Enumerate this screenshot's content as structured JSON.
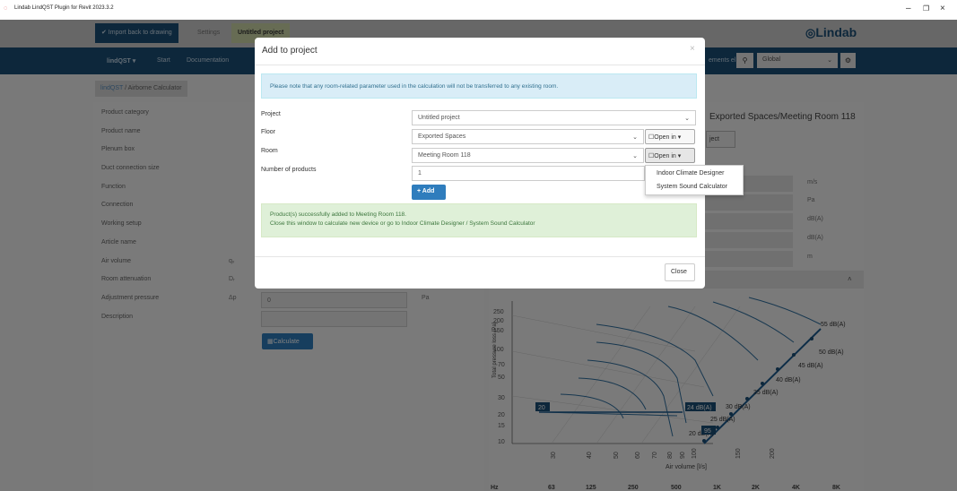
{
  "window": {
    "title": "Lindab LindQST Plugin for Revit 2023.3.2",
    "min": "–",
    "max": "❐",
    "close": "×"
  },
  "topbar": {
    "import": "✔ Import back to drawing",
    "settings": "Settings",
    "project": "Untitled project",
    "logo": "Lindab"
  },
  "navbar": {
    "menu": "lindQST ▾",
    "start": "Start",
    "docs": "Documentation",
    "search_hint": "ements el",
    "scope": "Global"
  },
  "breadcrumb": {
    "root": "lindQST",
    "sep": " / ",
    "page": "Airborne Calculator"
  },
  "form": {
    "labels": [
      "Product category",
      "Product name",
      "Plenum box",
      "Duct connection size",
      "Function",
      "Connection",
      "Working setup",
      "Article name",
      "Air volume",
      "Room attenuation",
      "Adjustment pressure",
      "Description"
    ],
    "symbols": {
      "air": "qᵥ",
      "room": "Dᵣ",
      "adj": "Δp"
    },
    "adj_value": "0",
    "adj_unit": "Pa",
    "calculate": "▦Calculate"
  },
  "right": {
    "title": "Exported Spaces/Meeting Room 118",
    "project_btn": "ject",
    "units": [
      "m/s",
      "Pa",
      "dB(A)",
      "dB(A)",
      "m"
    ]
  },
  "chart_data": {
    "type": "line",
    "ylabel": "Total pressure loss [Pa]",
    "xlabel": "Air volume [l/s]",
    "yticks": [
      "250",
      "200",
      "150",
      "100",
      "70",
      "50",
      "30",
      "20",
      "15",
      "10"
    ],
    "xticks": [
      "30",
      "40",
      "50",
      "60",
      "70",
      "80",
      "90",
      "100",
      "150",
      "200"
    ],
    "sound_labels": [
      "55 dB(A)",
      "50 dB(A)",
      "45 dB(A)",
      "40 dB(A)",
      "35 dB(A)",
      "30 dB(A)",
      "25 dB(A)",
      "20 dB(A)",
      "24 dB(A)"
    ],
    "markers": [
      "20",
      "95"
    ],
    "hz_row": [
      "Hz",
      "63",
      "125",
      "250",
      "500",
      "1K",
      "2K",
      "4K",
      "8K"
    ]
  },
  "modal": {
    "title": "Add to project",
    "close": "×",
    "info": "Please note that any room-related parameter used in the calculation will not be transferred to any existing room.",
    "fields": [
      {
        "label": "Project",
        "value": "Untitled project"
      },
      {
        "label": "Floor",
        "value": "Exported Spaces"
      },
      {
        "label": "Room",
        "value": "Meeting Room 118"
      },
      {
        "label": "Number of products",
        "value": "1"
      }
    ],
    "open_in": "☐Open in ▾",
    "add": "+ Add",
    "success1": "Product(s) successfully added to Meeting Room 118.",
    "success2": "Close this window to calculate new device or go to Indoor Climate Designer / System Sound Calculator",
    "close_btn": "Close"
  },
  "dropdown": [
    "Indoor Climate Designer",
    "System Sound Calculator"
  ]
}
